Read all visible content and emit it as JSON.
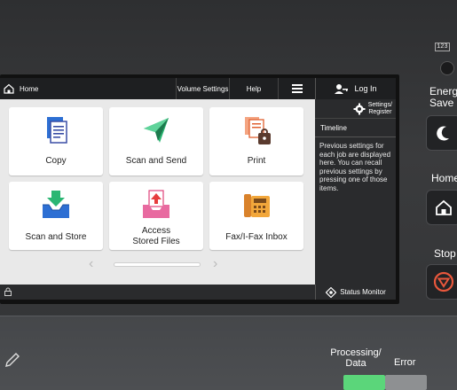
{
  "topbar": {
    "home_label": "Home",
    "volume_settings_label": "Volume Settings",
    "help_label": "Help",
    "login_label": "Log In"
  },
  "tiles": [
    {
      "label": "Copy",
      "icon": "copy-icon"
    },
    {
      "label": "Scan and Send",
      "icon": "scan-send-icon"
    },
    {
      "label": "Print",
      "icon": "print-icon"
    },
    {
      "label": "Scan and Store",
      "icon": "scan-store-icon"
    },
    {
      "label_line1": "Access",
      "label_line2": "Stored Files",
      "icon": "access-files-icon"
    },
    {
      "label": "Fax/I-Fax Inbox",
      "icon": "fax-inbox-icon"
    }
  ],
  "right_panel": {
    "settings_line1": "Settings/",
    "settings_line2": "Register",
    "timeline_title": "Timeline",
    "timeline_text": "Previous settings for each job are displayed here. You can recall previous settings by pressing one of those items."
  },
  "bottombar": {
    "status_monitor_label": "Status Monitor"
  },
  "hardware": {
    "small_label": "123",
    "energy_saver_line1": "Energ",
    "energy_saver_line2": "Save",
    "home_label": "Home",
    "stop_label": "Stop",
    "processing_line1": "Processing/",
    "processing_line2": "Data",
    "error_label": "Error"
  },
  "colors": {
    "screen_bg": "#e9e9e9",
    "bar_bg": "#1e1f21",
    "processing_led": "#5bd67a",
    "stop_icon": "#e8573c"
  }
}
